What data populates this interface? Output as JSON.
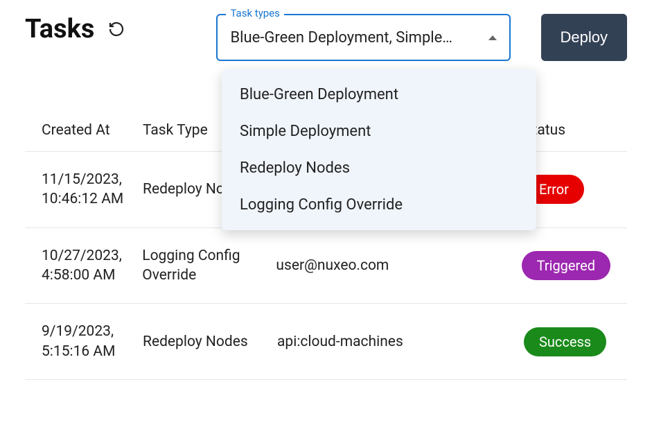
{
  "header": {
    "title": "Tasks",
    "deploy_label": "Deploy"
  },
  "filter": {
    "label": "Task types",
    "selected_display": "Blue-Green Deployment, Simple…",
    "options": [
      "Blue-Green Deployment",
      "Simple Deployment",
      "Redeploy Nodes",
      "Logging Config Override"
    ]
  },
  "table": {
    "columns": {
      "created": "Created At",
      "type": "Task Type",
      "status": "Status"
    },
    "rows": [
      {
        "created": "11/15/2023, 10:46:12 AM",
        "type": "Redeploy Nodes",
        "triggered_by": "",
        "status_label": "Error",
        "status_kind": "error"
      },
      {
        "created": "10/27/2023, 4:58:00 AM",
        "type": "Logging Config Override",
        "triggered_by": "user@nuxeo.com",
        "status_label": "Triggered",
        "status_kind": "triggered"
      },
      {
        "created": "9/19/2023, 5:15:16 AM",
        "type": "Redeploy Nodes",
        "triggered_by": "api:cloud-machines",
        "status_label": "Success",
        "status_kind": "success"
      }
    ]
  }
}
